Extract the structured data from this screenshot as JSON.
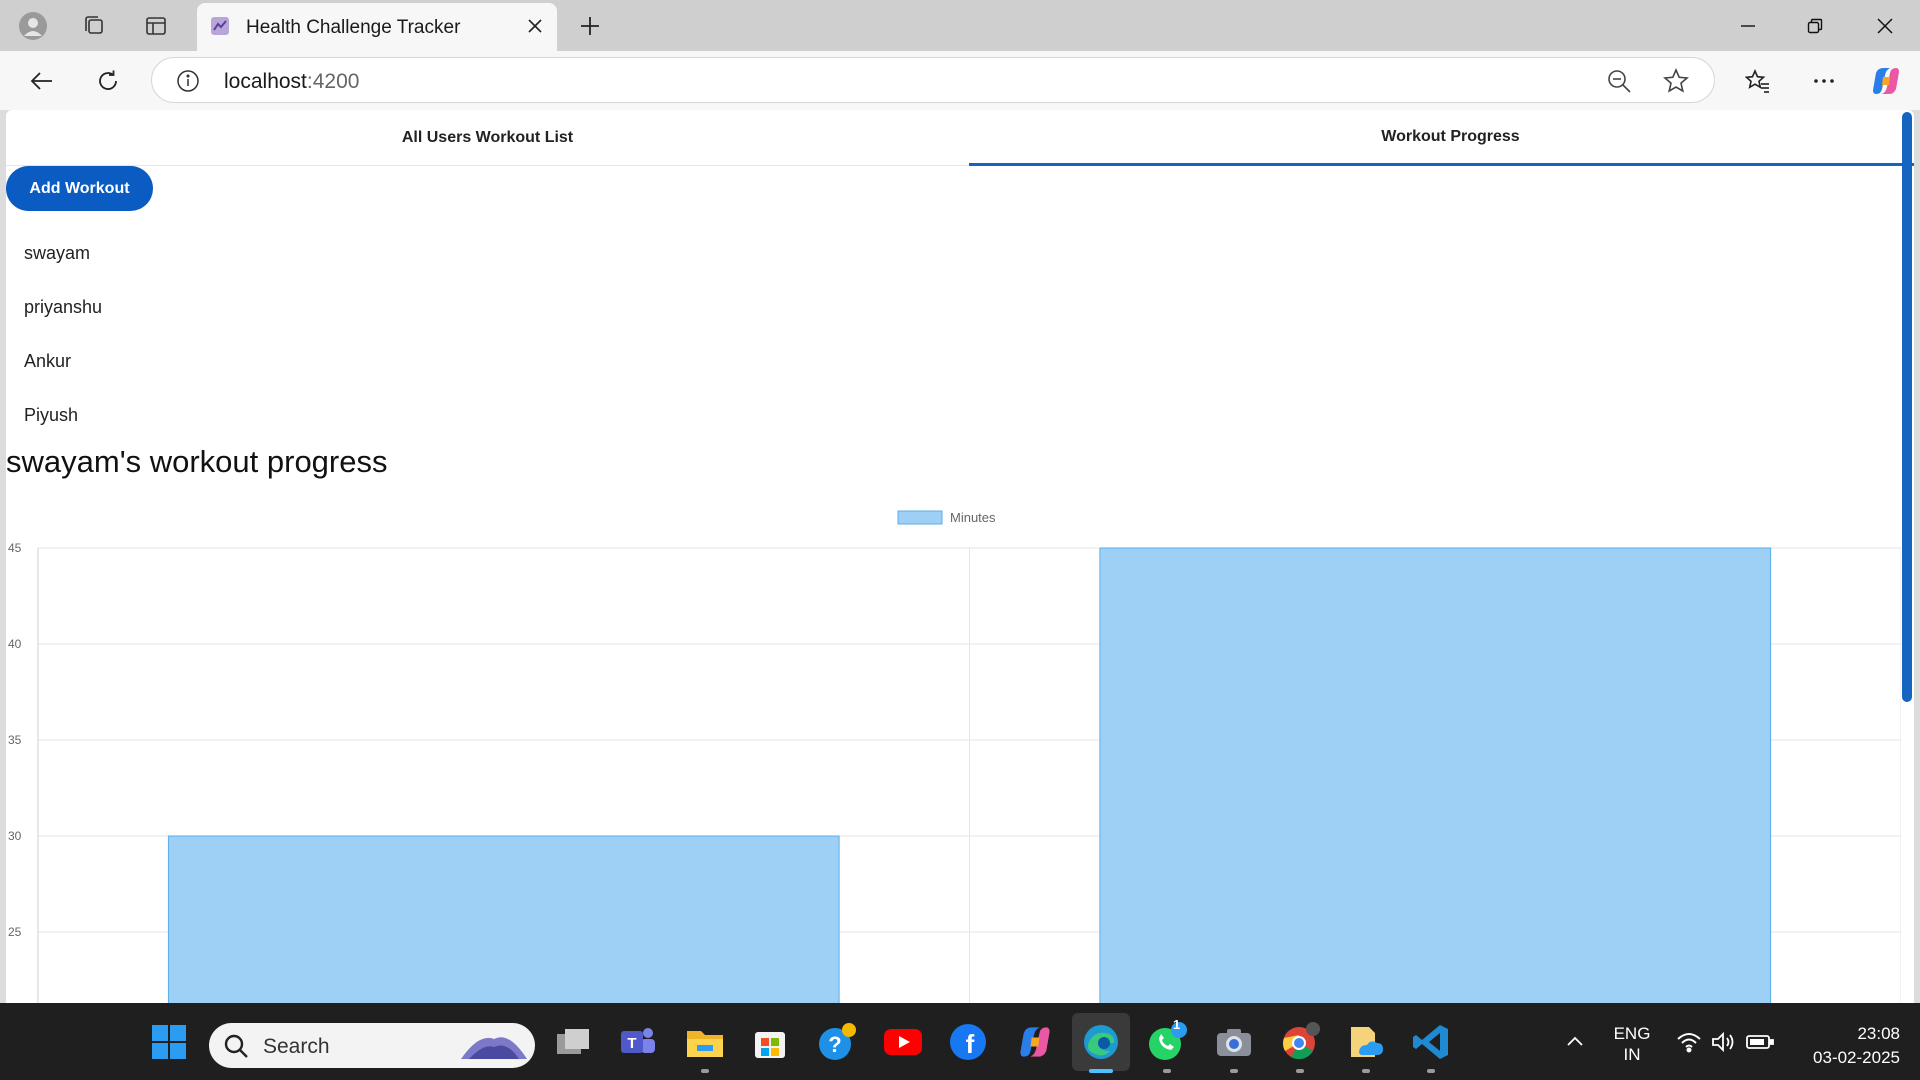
{
  "browser": {
    "tab_title": "Health Challenge Tracker",
    "url_host": "localhost",
    "url_port": ":4200"
  },
  "app": {
    "tabs": [
      {
        "label": "All Users Workout List",
        "active": false
      },
      {
        "label": "Workout Progress",
        "active": true
      }
    ],
    "add_button_label": "Add Workout",
    "users": [
      "swayam",
      "priyanshu",
      "Ankur",
      "Piyush"
    ],
    "progress_title": "swayam's workout progress"
  },
  "chart_data": {
    "type": "bar",
    "categories": [
      "",
      ""
    ],
    "series": [
      {
        "name": "Minutes",
        "values": [
          30,
          45
        ],
        "color": "#9ecff5"
      }
    ],
    "yticks": [
      45,
      40,
      35,
      30,
      25
    ],
    "ylim": [
      22.5,
      45
    ],
    "legend_position": "top-center",
    "grid": true
  },
  "taskbar": {
    "search_placeholder": "Search",
    "language": "ENG",
    "region": "IN",
    "time": "23:08",
    "date": "03-02-2025",
    "whatsapp_badge": "1"
  },
  "colors": {
    "accent": "#1565c0",
    "button": "#0b5cc2",
    "bar_fill": "#9ecff5",
    "bar_border": "#5aaee9"
  }
}
